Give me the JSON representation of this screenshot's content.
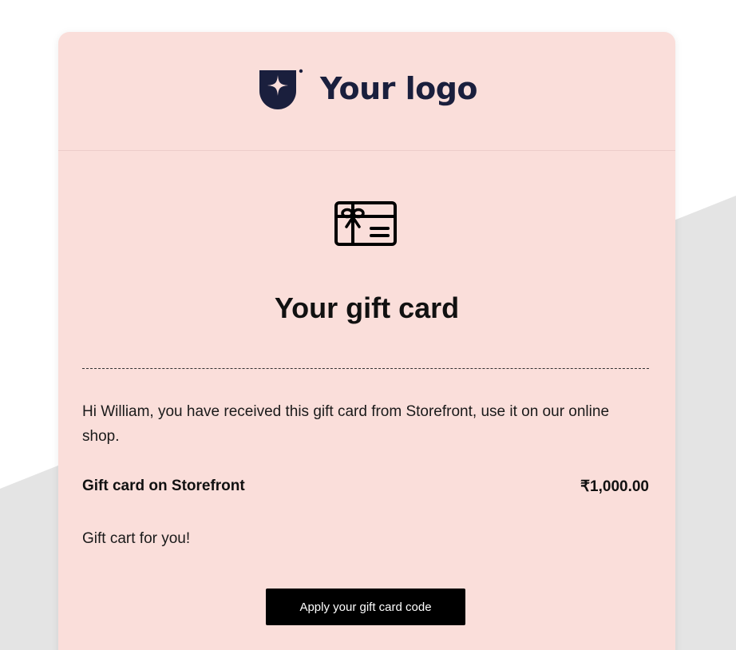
{
  "logo": {
    "text": "Your logo"
  },
  "email": {
    "title": "Your gift card",
    "message": "Hi William, you have received this gift card from Storefront, use it on our online shop.",
    "gift_card_name": "Gift card on Storefront",
    "gift_card_amount": "₹1,000.00",
    "note": "Gift cart for you!",
    "cta_label": "Apply your gift card code"
  },
  "colors": {
    "card_background": "#fadeda",
    "logo_color": "#1a1f3d",
    "page_wedge": "#e4e4e4",
    "button_background": "#000000"
  },
  "icons": {
    "logo_mark": "shield-star-icon",
    "gift_card": "gift-card-icon"
  }
}
